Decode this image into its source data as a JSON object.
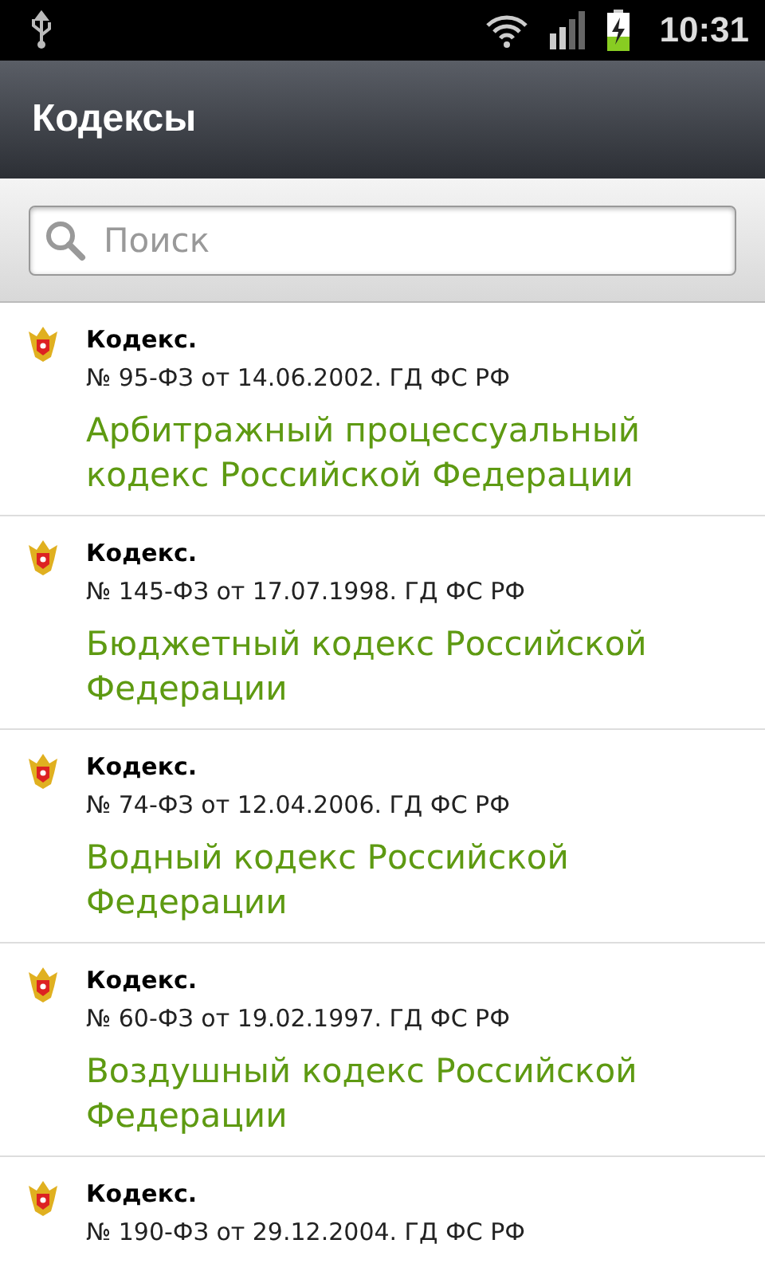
{
  "status_bar": {
    "time": "10:31"
  },
  "action_bar": {
    "title": "Кодексы"
  },
  "search": {
    "placeholder": "Поиск"
  },
  "items": [
    {
      "type": "Кодекс.",
      "number": "№ 95-ФЗ от 14.06.2002. ГД ФС РФ",
      "title": "Арбитражный процессуальный кодекс Российской Федерации"
    },
    {
      "type": "Кодекс.",
      "number": "№ 145-ФЗ от 17.07.1998. ГД ФС РФ",
      "title": "Бюджетный кодекс Российской Федерации"
    },
    {
      "type": "Кодекс.",
      "number": "№ 74-ФЗ от 12.04.2006. ГД ФС РФ",
      "title": "Водный кодекс Российской Федерации"
    },
    {
      "type": "Кодекс.",
      "number": "№ 60-ФЗ от 19.02.1997. ГД ФС РФ",
      "title": "Воздушный кодекс Российской Федерации"
    },
    {
      "type": "Кодекс.",
      "number": "№ 190-ФЗ от 29.12.2004. ГД ФС РФ"
    }
  ]
}
